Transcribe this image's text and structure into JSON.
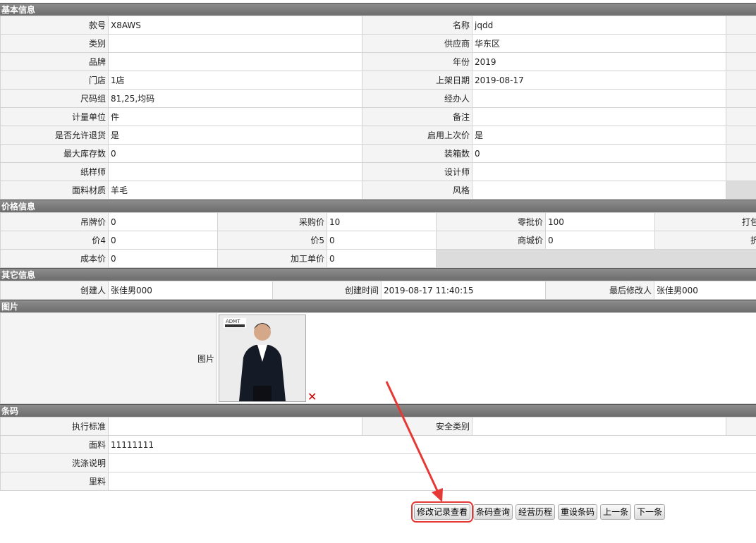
{
  "basic": {
    "title": "基本信息",
    "rows": [
      {
        "l1": "款号",
        "v1": "X8AWS",
        "l2": "名称",
        "v2": "jqdd"
      },
      {
        "l1": "类别",
        "v1": "",
        "l2": "供应商",
        "v2": "华东区"
      },
      {
        "l1": "品牌",
        "v1": "",
        "l2": "年份",
        "v2": "2019"
      },
      {
        "l1": "门店",
        "v1": "1店",
        "l2": "上架日期",
        "v2": "2019-08-17"
      },
      {
        "l1": "尺码组",
        "v1": "81,25,均码",
        "l2": "经办人",
        "v2": ""
      },
      {
        "l1": "计量单位",
        "v1": "件",
        "l2": "备注",
        "v2": ""
      },
      {
        "l1": "是否允许退货",
        "v1": "是",
        "l2": "启用上次价",
        "v2": "是"
      },
      {
        "l1": "最大库存数",
        "v1": "0",
        "l2": "装箱数",
        "v2": "0"
      },
      {
        "l1": "纸样师",
        "v1": "",
        "l2": "设计师",
        "v2": ""
      },
      {
        "l1": "面料材质",
        "v1": "羊毛",
        "l2": "风格",
        "v2": ""
      }
    ]
  },
  "price": {
    "title": "价格信息",
    "rows": [
      {
        "l1": "吊牌价",
        "v1": "0",
        "l2": "采购价",
        "v2": "10",
        "l3": "零批价",
        "v3": "100",
        "l4": "打包价"
      },
      {
        "l1": "价4",
        "v1": "0",
        "l2": "价5",
        "v2": "0",
        "l3": "商城价",
        "v3": "0",
        "l4": "折扣"
      },
      {
        "l1": "成本价",
        "v1": "0",
        "l2": "加工单价",
        "v2": "0"
      }
    ]
  },
  "other": {
    "title": "其它信息",
    "creator_label": "创建人",
    "creator": "张佳男000",
    "created_label": "创建时间",
    "created": "2019-08-17 11:40:15",
    "modifier_label": "最后修改人",
    "modifier": "张佳男000"
  },
  "image": {
    "title": "图片",
    "label": "图片",
    "logo_text": "ADMT",
    "delete_icon": "✕"
  },
  "barcode": {
    "title": "条码",
    "std_label": "执行标准",
    "std": "",
    "safety_label": "安全类别",
    "safety": "",
    "fabric_label": "面料",
    "fabric": "11111111",
    "wash_label": "洗涤说明",
    "wash": "",
    "lining_label": "里料",
    "lining": ""
  },
  "actions": {
    "history": "修改记录查看",
    "barcode_query": "条码查询",
    "ops_history": "经营历程",
    "reset_barcode": "重设条码",
    "prev": "上一条",
    "next": "下一条"
  },
  "colors": {
    "annotation": "#e53935",
    "section_header": "#7a7a7a",
    "delete": "#cc0000"
  }
}
